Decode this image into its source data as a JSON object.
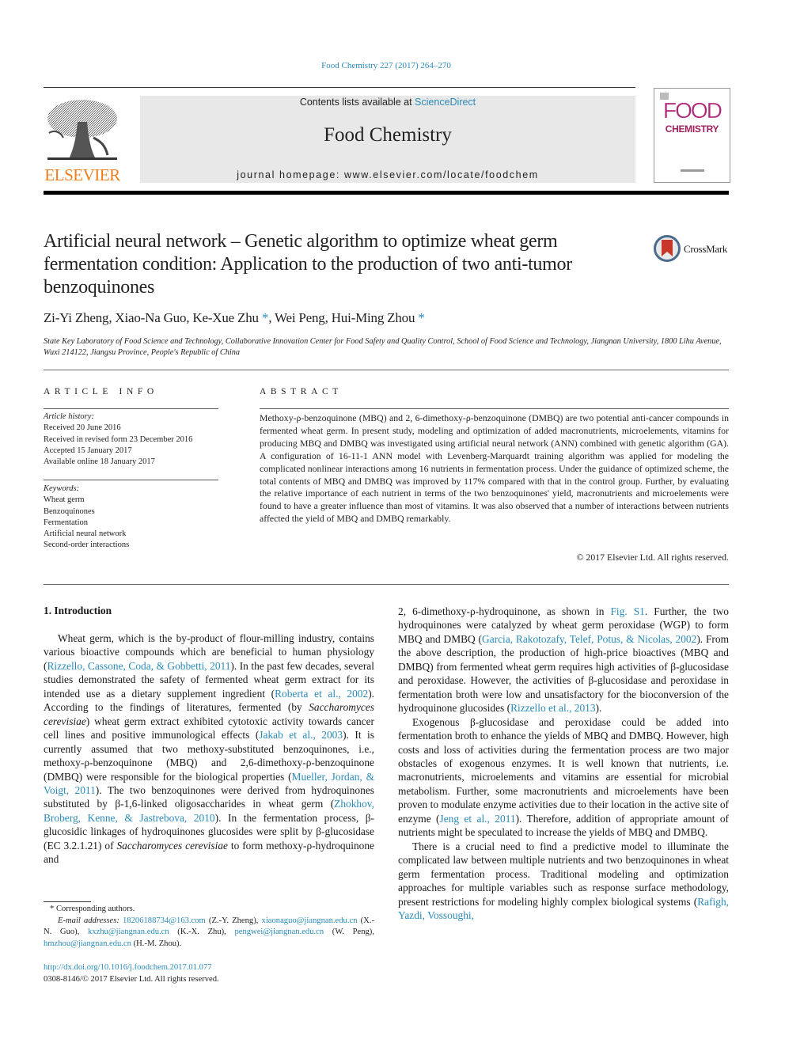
{
  "header": {
    "citation": "Food Chemistry 227 (2017) 264–270",
    "contents_prefix": "Contents lists available at ",
    "contents_link": "ScienceDirect",
    "journal_name": "Food Chemistry",
    "homepage": "journal homepage: www.elsevier.com/locate/foodchem",
    "publisher_logo_text": "ELSEVIER",
    "cover": {
      "word1": "FOOD",
      "word2": "CHEMISTRY"
    }
  },
  "colors": {
    "link": "#2a8ab8",
    "elsevier_orange": "#f07d1a",
    "cover_magenta": "#b0267a",
    "banner_bg": "#e8e8e8"
  },
  "article": {
    "title": "Artificial neural network – Genetic algorithm to optimize wheat germ fermentation condition: Application to the production of two anti-tumor benzoquinones",
    "crossmark_label": "CrossMark",
    "authors": [
      {
        "name": "Zi-Yi Zheng",
        "corresponding": false
      },
      {
        "name": "Xiao-Na Guo",
        "corresponding": false
      },
      {
        "name": "Ke-Xue Zhu",
        "corresponding": true
      },
      {
        "name": "Wei Peng",
        "corresponding": false
      },
      {
        "name": "Hui-Ming Zhou",
        "corresponding": true
      }
    ],
    "author_sep": ", ",
    "star": "*",
    "affiliation": "State Key Laboratory of Food Science and Technology, Collaborative Innovation Center for Food Safety and Quality Control, School of Food Science and Technology, Jiangnan University, 1800 Lihu Avenue, Wuxi 214122, Jiangsu Province, People's Republic of China"
  },
  "article_info": {
    "heading": "ARTICLE INFO",
    "history_label": "Article history:",
    "history": [
      "Received 20 June 2016",
      "Received in revised form 23 December 2016",
      "Accepted 15 January 2017",
      "Available online 18 January 2017"
    ],
    "keywords_label": "Keywords:",
    "keywords": [
      "Wheat germ",
      "Benzoquinones",
      "Fermentation",
      "Artificial neural network",
      "Second-order interactions"
    ]
  },
  "abstract": {
    "heading": "ABSTRACT",
    "text": "Methoxy-ρ-benzoquinone (MBQ) and 2, 6-dimethoxy-ρ-benzoquinone (DMBQ) are two potential anti-cancer compounds in fermented wheat germ. In present study, modeling and optimization of added macronutrients, microelements, vitamins for producing MBQ and DMBQ was investigated using artificial neural network (ANN) combined with genetic algorithm (GA). A configuration of 16-11-1 ANN model with Levenberg-Marquardt training algorithm was applied for modeling the complicated nonlinear interactions among 16 nutrients in fermentation process. Under the guidance of optimized scheme, the total contents of MBQ and DMBQ was improved by 117% compared with that in the control group. Further, by evaluating the relative importance of each nutrient in terms of the two benzoquinones' yield, macronutrients and microelements were found to have a greater influence than most of vitamins. It was also observed that a number of interactions between nutrients affected the yield of MBQ and DMBQ remarkably.",
    "copyright": "© 2017 Elsevier Ltd. All rights reserved."
  },
  "body": {
    "section_heading": "1. Introduction",
    "left_paragraphs": [
      [
        {
          "t": "Wheat germ, which is the by-product of flour-milling industry, contains various bioactive compounds which are beneficial to human physiology ("
        },
        {
          "t": "Rizzello, Cassone, Coda, & Gobbetti, 2011",
          "link": true
        },
        {
          "t": "). In the past few decades, several studies demonstrated the safety of fermented wheat germ extract for its intended use as a dietary supplement ingredient ("
        },
        {
          "t": "Roberta et al., 2002",
          "link": true
        },
        {
          "t": "). According to the findings of literatures, fermented (by "
        },
        {
          "t": "Saccharomyces cerevisiae",
          "italic": true
        },
        {
          "t": ") wheat germ extract exhibited cytotoxic activity towards cancer cell lines and positive immunological effects ("
        },
        {
          "t": "Jakab et al., 2003",
          "link": true
        },
        {
          "t": "). It is currently assumed that two methoxy-substituted benzoquinones, i.e., methoxy-ρ-benzoquinone (MBQ) and 2,6-dimethoxy-ρ-benzoquinone (DMBQ) were responsible for the biological properties ("
        },
        {
          "t": "Mueller, Jordan, & Voigt, 2011",
          "link": true
        },
        {
          "t": "). The two benzoquinones were derived from hydroquinones substituted by β-1,6-linked oligosaccharides in wheat germ ("
        },
        {
          "t": "Zhokhov, Broberg, Kenne, & Jastrebova, 2010",
          "link": true
        },
        {
          "t": "). In the fermentation process, β-glucosidic linkages of hydroquinones glucosides were split by β-glucosidase (EC 3.2.1.21) of "
        },
        {
          "t": "Saccharomyces cerevisiae",
          "italic": true
        },
        {
          "t": " to form methoxy-ρ-hydroquinone and"
        }
      ]
    ],
    "right_paragraphs": [
      [
        {
          "t": "2, 6-dimethoxy-ρ-hydroquinone, as shown in "
        },
        {
          "t": "Fig. S1",
          "link": true
        },
        {
          "t": ". Further, the two hydroquinones were catalyzed by wheat germ peroxidase (WGP) to form MBQ and DMBQ ("
        },
        {
          "t": "Garcia, Rakotozafy, Telef, Potus, & Nicolas, 2002",
          "link": true
        },
        {
          "t": "). From the above description, the production of high-price bioactives (MBQ and DMBQ) from fermented wheat germ requires high activities of β-glucosidase and peroxidase. However, the activities of β-glucosidase and peroxidase in fermentation broth were low and unsatisfactory for the bioconversion of the hydroquinone glucosides ("
        },
        {
          "t": "Rizzello et al., 2013",
          "link": true
        },
        {
          "t": ")."
        }
      ],
      [
        {
          "t": "Exogenous β-glucosidase and peroxidase could be added into fermentation broth to enhance the yields of MBQ and DMBQ. However, high costs and loss of activities during the fermentation process are two major obstacles of exogenous enzymes. It is well known that nutrients, i.e. macronutrients, microelements and vitamins are essential for microbial metabolism. Further, some macronutrients and microelements have been proven to modulate enzyme activities due to their location in the active site of enzyme ("
        },
        {
          "t": "Jeng et al., 2011",
          "link": true
        },
        {
          "t": "). Therefore, addition of appropriate amount of nutrients might be speculated to increase the yields of MBQ and DMBQ."
        }
      ],
      [
        {
          "t": "There is a crucial need to find a predictive model to illuminate the complicated law between multiple nutrients and two benzoquinones in wheat germ fermentation process. Traditional modeling and optimization approaches for multiple variables such as response surface methodology, present restrictions for modeling highly complex biological systems ("
        },
        {
          "t": "Rafigh, Yazdi, Vossoughi,",
          "link": true
        }
      ]
    ]
  },
  "footnotes": {
    "corresponding": "* Corresponding authors.",
    "email_label": "E-mail addresses:",
    "emails": [
      {
        "address": "18206188734@163.com",
        "who": "(Z.-Y. Zheng)"
      },
      {
        "address": "xiaonaguo@jiangnan.edu.cn",
        "who": "(X.-N. Guo)"
      },
      {
        "address": "kxzhu@jiangnan.edu.cn",
        "who": "(K.-X. Zhu)"
      },
      {
        "address": "pengwei@jiangnan.edu.cn",
        "who": "(W. Peng)"
      },
      {
        "address": "hmzhou@jiangnan.edu.cn",
        "who": "(H.-M. Zhou)"
      }
    ],
    "doi": "http://dx.doi.org/10.1016/j.foodchem.2017.01.077",
    "issn_line": "0308-8146/© 2017 Elsevier Ltd. All rights reserved."
  }
}
